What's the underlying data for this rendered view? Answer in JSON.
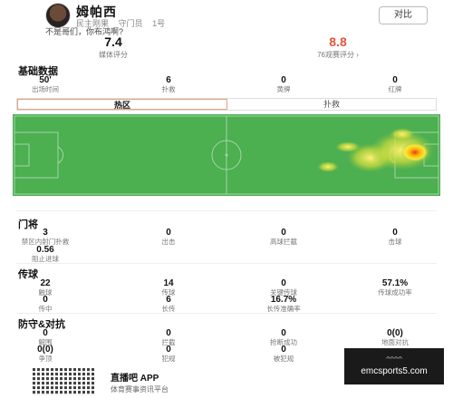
{
  "player": {
    "name": "姆帕西",
    "team": "民主刚果",
    "position": "守门员",
    "number": "1号",
    "compare_label": "对比"
  },
  "comment": {
    "text_a": "不是哥们，你布鸿啊?",
    "text_b": ""
  },
  "ratings": {
    "media_value": "7.4",
    "media_label": "媒体评分",
    "fans_value": "8.8",
    "fans_label": "76观赛评分 ›"
  },
  "basic": {
    "title": "基础数据",
    "items": [
      {
        "value": "50'",
        "label": "出场时间"
      },
      {
        "value": "6",
        "label": "扑救"
      },
      {
        "value": "0",
        "label": "黄牌"
      },
      {
        "value": "0",
        "label": "红牌"
      }
    ]
  },
  "tabs": [
    {
      "label": "热区"
    },
    {
      "label": "扑救"
    }
  ],
  "goalkeeper": {
    "title": "门将",
    "items": [
      {
        "value": "3",
        "label": "禁区内射门扑救"
      },
      {
        "value": "0",
        "label": "出击"
      },
      {
        "value": "0",
        "label": "高球拦截"
      },
      {
        "value": "0",
        "label": "击球"
      },
      {
        "value": "0.56",
        "label": "阻止进球"
      }
    ]
  },
  "passing": {
    "title": "传球",
    "items": [
      {
        "value": "22",
        "label": "触球"
      },
      {
        "value": "14",
        "label": "传球"
      },
      {
        "value": "0",
        "label": "关键传球"
      },
      {
        "value": "57.1%",
        "label": "传球成功率"
      },
      {
        "value": "0",
        "label": "传中"
      },
      {
        "value": "6",
        "label": "长传"
      },
      {
        "value": "16.7%",
        "label": "长传准确率"
      }
    ]
  },
  "defense": {
    "title": "防守&对抗",
    "items": [
      {
        "value": "0",
        "label": "解围"
      },
      {
        "value": "0",
        "label": "拦截"
      },
      {
        "value": "0",
        "label": "抢断成功"
      },
      {
        "value": "0(0)",
        "label": "地面对抗"
      },
      {
        "value": "0(0)",
        "label": "争顶"
      },
      {
        "value": "0",
        "label": "犯规"
      },
      {
        "value": "0",
        "label": "被犯规"
      },
      {
        "value": "0",
        "label": ""
      }
    ]
  },
  "footer": {
    "app_title": "直播吧 APP",
    "app_sub": "体育赛事资讯平台"
  },
  "overlay": {
    "line1": "𝄐𝄐𝄐𝄐",
    "line2": "emcsports5.com"
  },
  "colors": {
    "pitch": "#4caf50",
    "fans_rating": "#e0573a",
    "heat_hot": "#e53935"
  }
}
